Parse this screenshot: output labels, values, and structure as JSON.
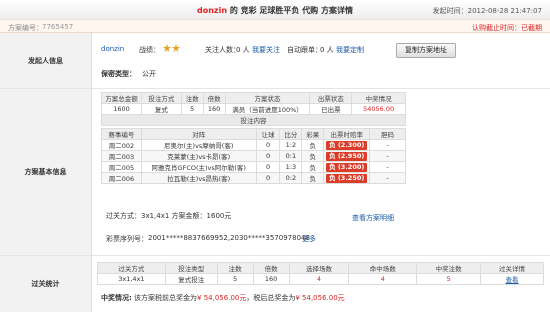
{
  "header": {
    "user": "donzin",
    "title_rest": " 的 竞彩 足球胜平负 代购 方案详情",
    "time_label": "发起时间：",
    "time_value": "2012-08-28 21:47:07"
  },
  "idbar": {
    "label": "方案编号：",
    "value": "7765457",
    "right_text": "认购截止时间：已截期"
  },
  "initiator": {
    "section_label": "发起人信息",
    "username": "donzin",
    "record_label": "战绩：",
    "record_icon": "trophy-stars-icon",
    "followers_text": "关注人数：",
    "followers_count": "0 人",
    "follow_link": "我要关注",
    "auto_follow_text": "自动跟单：",
    "auto_follow_count": "0 人",
    "custom_link": "我要定制",
    "copy_button": "复制方案地址",
    "privacy_label": "保密类型：",
    "privacy_value": "公开"
  },
  "plan": {
    "section_label": "方案基本信息",
    "summary_headers": [
      "方案总金额",
      "投注方式",
      "注数",
      "倍数",
      "方案状态",
      "出票状态",
      "中奖情况"
    ],
    "summary_row": [
      "1600",
      "复式",
      "5",
      "160",
      "满员（当前进度100%）",
      "已出票",
      "54056.00"
    ],
    "bet_content_label": "投注内容",
    "match_headers": [
      "赛事编号",
      "对阵",
      "让球",
      "比分",
      "彩果",
      "出票时赔率",
      "胆码"
    ],
    "matches": [
      {
        "id": "周二002",
        "vs": "尼奥尔(主)vs摩纳哥(客)",
        "handicap": "0",
        "score": "1:2",
        "result": "负",
        "odds": "负 (2.300)",
        "banker": "-"
      },
      {
        "id": "周二003",
        "vs": "克莱蒙(主)vs卡昂(客)",
        "handicap": "0",
        "score": "0:1",
        "result": "负",
        "odds": "负 (2.950)",
        "banker": "-"
      },
      {
        "id": "周二005",
        "vs": "阿雅克肖GFCO(主)vs阿尔勒(客)",
        "handicap": "0",
        "score": "1:3",
        "result": "负",
        "odds": "负 (3.200)",
        "banker": "-"
      },
      {
        "id": "周二006",
        "vs": "拉瓦勒(主)vs昂热(客)",
        "handicap": "0",
        "score": "0:2",
        "result": "负",
        "odds": "负 (3.250)",
        "banker": "-"
      }
    ],
    "pass_text": "过关方式：3x1,4x1    方案金额：1600元",
    "view_detail_link": "查看方案明细",
    "ticket_label": "彩票序列号：",
    "ticket_value": "2001*****8837669952,2030*****3570978048",
    "more_link": "更多"
  },
  "stats": {
    "section_label": "过关统计",
    "headers": [
      "过关方式",
      "投注类型",
      "注数",
      "倍数",
      "选择场数",
      "命中场数",
      "中奖注数",
      "过关详情"
    ],
    "row": [
      "3x1,4x1",
      "复式投注",
      "5",
      "160",
      "4",
      "4",
      "5",
      "查看"
    ],
    "prize_label": "中奖情况:",
    "prize_prefix": "该方案税前总奖金为",
    "prize_pre_tax": "¥ 54,056.00元",
    "prize_mid": "，税后总奖金为",
    "prize_post_tax": "¥ 54,056.00元"
  },
  "colors": {
    "accent_red": "#dc3c2a",
    "link_blue": "#1a5aa8"
  }
}
